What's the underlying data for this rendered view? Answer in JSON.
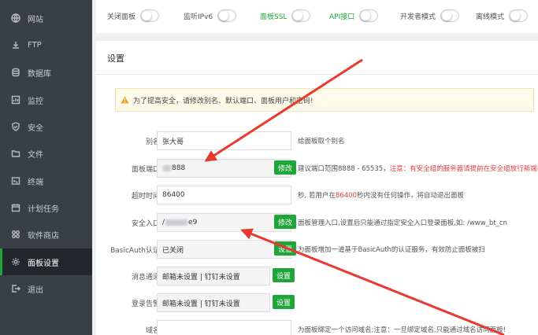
{
  "sidebar": {
    "items": [
      {
        "label": "网站",
        "icon": "globe-icon"
      },
      {
        "label": "FTP",
        "icon": "ftp-icon"
      },
      {
        "label": "数据库",
        "icon": "database-icon"
      },
      {
        "label": "监控",
        "icon": "monitor-icon"
      },
      {
        "label": "安全",
        "icon": "shield-icon"
      },
      {
        "label": "文件",
        "icon": "folder-icon"
      },
      {
        "label": "终端",
        "icon": "terminal-icon"
      },
      {
        "label": "计划任务",
        "icon": "calendar-icon"
      },
      {
        "label": "软件商店",
        "icon": "grid-icon"
      },
      {
        "label": "面板设置",
        "icon": "gear-icon"
      },
      {
        "label": "退出",
        "icon": "logout-icon"
      }
    ]
  },
  "toggles": [
    {
      "label": "关闭面板"
    },
    {
      "label": "监听IPv6"
    },
    {
      "label": "面板SSL"
    },
    {
      "label": "API接口"
    },
    {
      "label": "开发者模式"
    },
    {
      "label": "离线模式"
    }
  ],
  "settings": {
    "title": "设置",
    "warning": "为了提高安全，请修改别名、默认端口、面板用户和密码!",
    "alias": {
      "label": "别名",
      "value": "张大哥",
      "hint": "给面板取个别名"
    },
    "port": {
      "label": "面板端口",
      "value_suffix": "888",
      "button": "修改",
      "hint": "建议端口范围8888 - 65535，",
      "hint_red": "注意：有安全组的服务器请提前在安全组放行新端口"
    },
    "timeout": {
      "label": "超时时间",
      "value": "86400",
      "hint_a": "秒, 若用户在",
      "hint_red": "86400",
      "hint_b": "秒内没有任何操作，将自动退出面板"
    },
    "entry": {
      "label": "安全入口",
      "value_prefix": "/",
      "value_suffix": "e9",
      "button": "修改",
      "hint": "面板管理入口,设置后只能通过指定安全入口登录面板,如: /www_bt_cn"
    },
    "basic_auth": {
      "label": "BasicAuth认证",
      "value": "已关闭",
      "button": "设置",
      "hint": "为面板增加一道基于BasicAuth的认证服务，有效防止面板被扫"
    },
    "message": {
      "label": "消息通道",
      "value": "邮箱未设置 | 钉钉未设置",
      "button": "设置"
    },
    "alarm": {
      "label": "登录告警",
      "value": "邮箱未设置 | 钉钉未设置",
      "button": "设置"
    },
    "domain": {
      "label": "域名",
      "value": "",
      "hint": "为面板绑定一个访问域名;注意：一旦绑定域名,只能通过域名访问面板!"
    }
  },
  "colors": {
    "accent": "#20a53a",
    "sidebar": "#3a3f44",
    "arrow": "#e8392f"
  }
}
